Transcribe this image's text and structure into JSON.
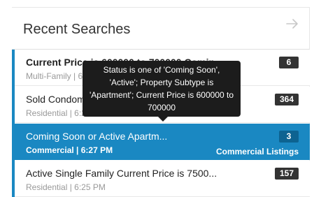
{
  "header": {
    "title": "Recent Searches",
    "arrow_icon": "arrow-right-icon"
  },
  "searches": [
    {
      "title": "Current Price is 600000 to 700000 Comin...",
      "meta": "Multi-Family | 6:28 PM",
      "count": "6",
      "label": ""
    },
    {
      "title": "Sold Condominium Current Price is 600000...",
      "meta": "Residential | 6:28 PM",
      "count": "364",
      "label": ""
    },
    {
      "title": "Coming Soon or Active Apartm...",
      "meta": "Commercial | 6:27 PM",
      "count": "3",
      "label": "Commercial Listings"
    },
    {
      "title": "Active Single Family Current Price is 7500...",
      "meta": "Residential | 6:25 PM",
      "count": "157",
      "label": ""
    }
  ],
  "tooltip": {
    "text": "Status is one of 'Coming Soon', 'Active'; Property Subtype is 'Apartment'; Current Price is 600000 to 700000"
  },
  "colors": {
    "accent": "#1a88c2",
    "badge": "#333333",
    "tooltip": "#1c1c1c"
  }
}
